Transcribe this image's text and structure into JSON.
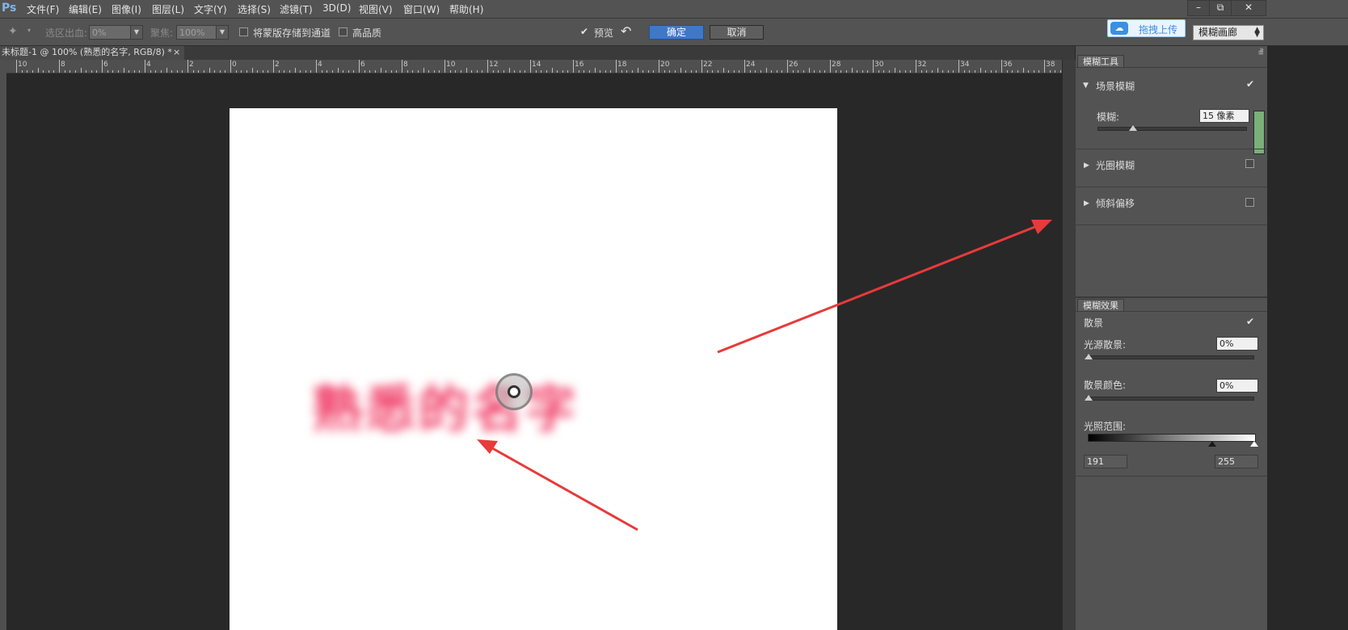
{
  "app": {
    "logo": "Ps",
    "menu": [
      "文件(F)",
      "编辑(E)",
      "图像(I)",
      "图层(L)",
      "文字(Y)",
      "选择(S)",
      "滤镜(T)",
      "3D(D)",
      "视图(V)",
      "窗口(W)",
      "帮助(H)"
    ],
    "window_buttons": [
      "–",
      "⧉",
      "✕"
    ]
  },
  "options": {
    "selection_bleed_label": "选区出血:",
    "selection_bleed_value": "0%",
    "focus_label": "聚焦:",
    "focus_value": "100%",
    "save_mask_label": "将蒙版存储到通道",
    "high_quality_label": "高品质",
    "preview_label": "预览",
    "ok_label": "确定",
    "cancel_label": "取消"
  },
  "upload": {
    "icon": "cloud-icon",
    "label": "拖拽上传"
  },
  "workspace": {
    "label": "模糊画廊",
    "icon": "updown-icon"
  },
  "document": {
    "tab_title": "未标题-1 @ 100% (熟悉的名字, RGB/8) *",
    "close": "×"
  },
  "ruler": {
    "labels": [
      "10",
      "8",
      "6",
      "4",
      "2",
      "0",
      "2",
      "4",
      "6",
      "8",
      "10",
      "12",
      "14",
      "16",
      "18",
      "20",
      "22",
      "24",
      "26",
      "28",
      "30",
      "32",
      "34",
      "36",
      "38"
    ]
  },
  "canvas": {
    "text": "熟悉的名字",
    "text_color": "#f03a64"
  },
  "blur_tools": {
    "tab": "模糊工具",
    "field_blur": {
      "label": "场景模糊",
      "checked": true
    },
    "blur_label": "模糊:",
    "blur_value": "15 像素",
    "blur_level": 0.24,
    "iris_blur": {
      "label": "光圈模糊",
      "checked": false
    },
    "tilt_shift": {
      "label": "倾斜偏移",
      "checked": false
    }
  },
  "blur_effects": {
    "tab": "模糊效果",
    "bokeh_label": "散景",
    "bokeh_checked": true,
    "light_bokeh_label": "光源散景:",
    "light_bokeh_value": "0%",
    "bokeh_color_label": "散景颜色:",
    "bokeh_color_value": "0%",
    "light_range_label": "光照范围:",
    "light_range_low": "191",
    "light_range_high": "255"
  },
  "colors": {
    "accent": "#3f78c7",
    "arrow": "#e83a3a"
  }
}
